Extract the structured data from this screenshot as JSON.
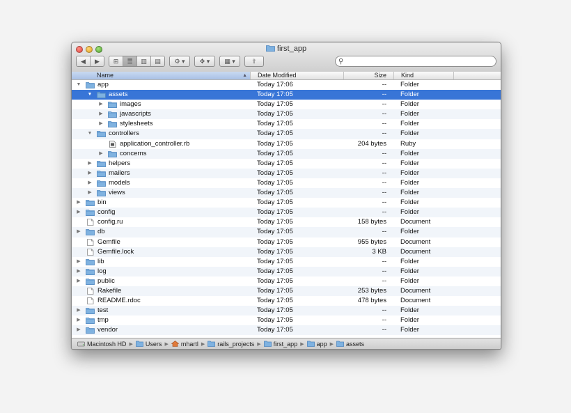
{
  "window": {
    "title": "first_app"
  },
  "toolbar": {
    "back_icon": "◀",
    "forward_icon": "▶",
    "view_icon": "⊞",
    "list_icon": "☰",
    "column_icon": "▥",
    "coverflow_icon": "▤",
    "action_icon": "⚙ ▾",
    "dropbox_icon": "✥ ▾",
    "arrange_icon": "▦ ▾",
    "share_icon": "⇪",
    "search_placeholder": "",
    "search_icon": "⚲"
  },
  "columns": {
    "name": "Name",
    "date": "Date Modified",
    "size": "Size",
    "kind": "Kind",
    "sort_arrow": "▲"
  },
  "rows": [
    {
      "name": "app",
      "date": "Today 17:06",
      "size": "--",
      "kind": "Folder",
      "level": 0,
      "type": "folder",
      "disclosure": "▼",
      "selected": false
    },
    {
      "name": "assets",
      "date": "Today 17:05",
      "size": "--",
      "kind": "Folder",
      "level": 1,
      "type": "folder",
      "disclosure": "▼",
      "selected": true
    },
    {
      "name": "images",
      "date": "Today 17:05",
      "size": "--",
      "kind": "Folder",
      "level": 2,
      "type": "folder",
      "disclosure": "▶",
      "selected": false
    },
    {
      "name": "javascripts",
      "date": "Today 17:05",
      "size": "--",
      "kind": "Folder",
      "level": 2,
      "type": "folder",
      "disclosure": "▶",
      "selected": false
    },
    {
      "name": "stylesheets",
      "date": "Today 17:05",
      "size": "--",
      "kind": "Folder",
      "level": 2,
      "type": "folder",
      "disclosure": "▶",
      "selected": false
    },
    {
      "name": "controllers",
      "date": "Today 17:05",
      "size": "--",
      "kind": "Folder",
      "level": 1,
      "type": "folder",
      "disclosure": "▼",
      "selected": false
    },
    {
      "name": "application_controller.rb",
      "date": "Today 17:05",
      "size": "204 bytes",
      "kind": "Ruby",
      "level": 2,
      "type": "ruby",
      "disclosure": "",
      "selected": false
    },
    {
      "name": "concerns",
      "date": "Today 17:05",
      "size": "--",
      "kind": "Folder",
      "level": 2,
      "type": "folder",
      "disclosure": "▶",
      "selected": false
    },
    {
      "name": "helpers",
      "date": "Today 17:05",
      "size": "--",
      "kind": "Folder",
      "level": 1,
      "type": "folder",
      "disclosure": "▶",
      "selected": false
    },
    {
      "name": "mailers",
      "date": "Today 17:05",
      "size": "--",
      "kind": "Folder",
      "level": 1,
      "type": "folder",
      "disclosure": "▶",
      "selected": false
    },
    {
      "name": "models",
      "date": "Today 17:05",
      "size": "--",
      "kind": "Folder",
      "level": 1,
      "type": "folder",
      "disclosure": "▶",
      "selected": false
    },
    {
      "name": "views",
      "date": "Today 17:05",
      "size": "--",
      "kind": "Folder",
      "level": 1,
      "type": "folder",
      "disclosure": "▶",
      "selected": false
    },
    {
      "name": "bin",
      "date": "Today 17:05",
      "size": "--",
      "kind": "Folder",
      "level": 0,
      "type": "folder",
      "disclosure": "▶",
      "selected": false
    },
    {
      "name": "config",
      "date": "Today 17:05",
      "size": "--",
      "kind": "Folder",
      "level": 0,
      "type": "folder",
      "disclosure": "▶",
      "selected": false
    },
    {
      "name": "config.ru",
      "date": "Today 17:05",
      "size": "158 bytes",
      "kind": "Document",
      "level": 0,
      "type": "document",
      "disclosure": "",
      "selected": false
    },
    {
      "name": "db",
      "date": "Today 17:05",
      "size": "--",
      "kind": "Folder",
      "level": 0,
      "type": "folder",
      "disclosure": "▶",
      "selected": false
    },
    {
      "name": "Gemfile",
      "date": "Today 17:05",
      "size": "955 bytes",
      "kind": "Document",
      "level": 0,
      "type": "document",
      "disclosure": "",
      "selected": false
    },
    {
      "name": "Gemfile.lock",
      "date": "Today 17:05",
      "size": "3 KB",
      "kind": "Document",
      "level": 0,
      "type": "document",
      "disclosure": "",
      "selected": false
    },
    {
      "name": "lib",
      "date": "Today 17:05",
      "size": "--",
      "kind": "Folder",
      "level": 0,
      "type": "folder",
      "disclosure": "▶",
      "selected": false
    },
    {
      "name": "log",
      "date": "Today 17:05",
      "size": "--",
      "kind": "Folder",
      "level": 0,
      "type": "folder",
      "disclosure": "▶",
      "selected": false
    },
    {
      "name": "public",
      "date": "Today 17:05",
      "size": "--",
      "kind": "Folder",
      "level": 0,
      "type": "folder",
      "disclosure": "▶",
      "selected": false
    },
    {
      "name": "Rakefile",
      "date": "Today 17:05",
      "size": "253 bytes",
      "kind": "Document",
      "level": 0,
      "type": "document",
      "disclosure": "",
      "selected": false
    },
    {
      "name": "README.rdoc",
      "date": "Today 17:05",
      "size": "478 bytes",
      "kind": "Document",
      "level": 0,
      "type": "document",
      "disclosure": "",
      "selected": false
    },
    {
      "name": "test",
      "date": "Today 17:05",
      "size": "--",
      "kind": "Folder",
      "level": 0,
      "type": "folder",
      "disclosure": "▶",
      "selected": false
    },
    {
      "name": "tmp",
      "date": "Today 17:05",
      "size": "--",
      "kind": "Folder",
      "level": 0,
      "type": "folder",
      "disclosure": "▶",
      "selected": false
    },
    {
      "name": "vendor",
      "date": "Today 17:05",
      "size": "--",
      "kind": "Folder",
      "level": 0,
      "type": "folder",
      "disclosure": "▶",
      "selected": false
    }
  ],
  "pathbar": {
    "separator": "▶",
    "items": [
      {
        "label": "Macintosh HD",
        "icon": "hard-drive-icon"
      },
      {
        "label": "Users",
        "icon": "folder-icon"
      },
      {
        "label": "mhartl",
        "icon": "home-icon"
      },
      {
        "label": "rails_projects",
        "icon": "folder-icon"
      },
      {
        "label": "first_app",
        "icon": "folder-icon"
      },
      {
        "label": "app",
        "icon": "folder-icon"
      },
      {
        "label": "assets",
        "icon": "folder-icon"
      }
    ]
  },
  "colors": {
    "selection": "#3875d7",
    "folder": "#7fb2e0",
    "stripe": "#f1f5fa"
  }
}
